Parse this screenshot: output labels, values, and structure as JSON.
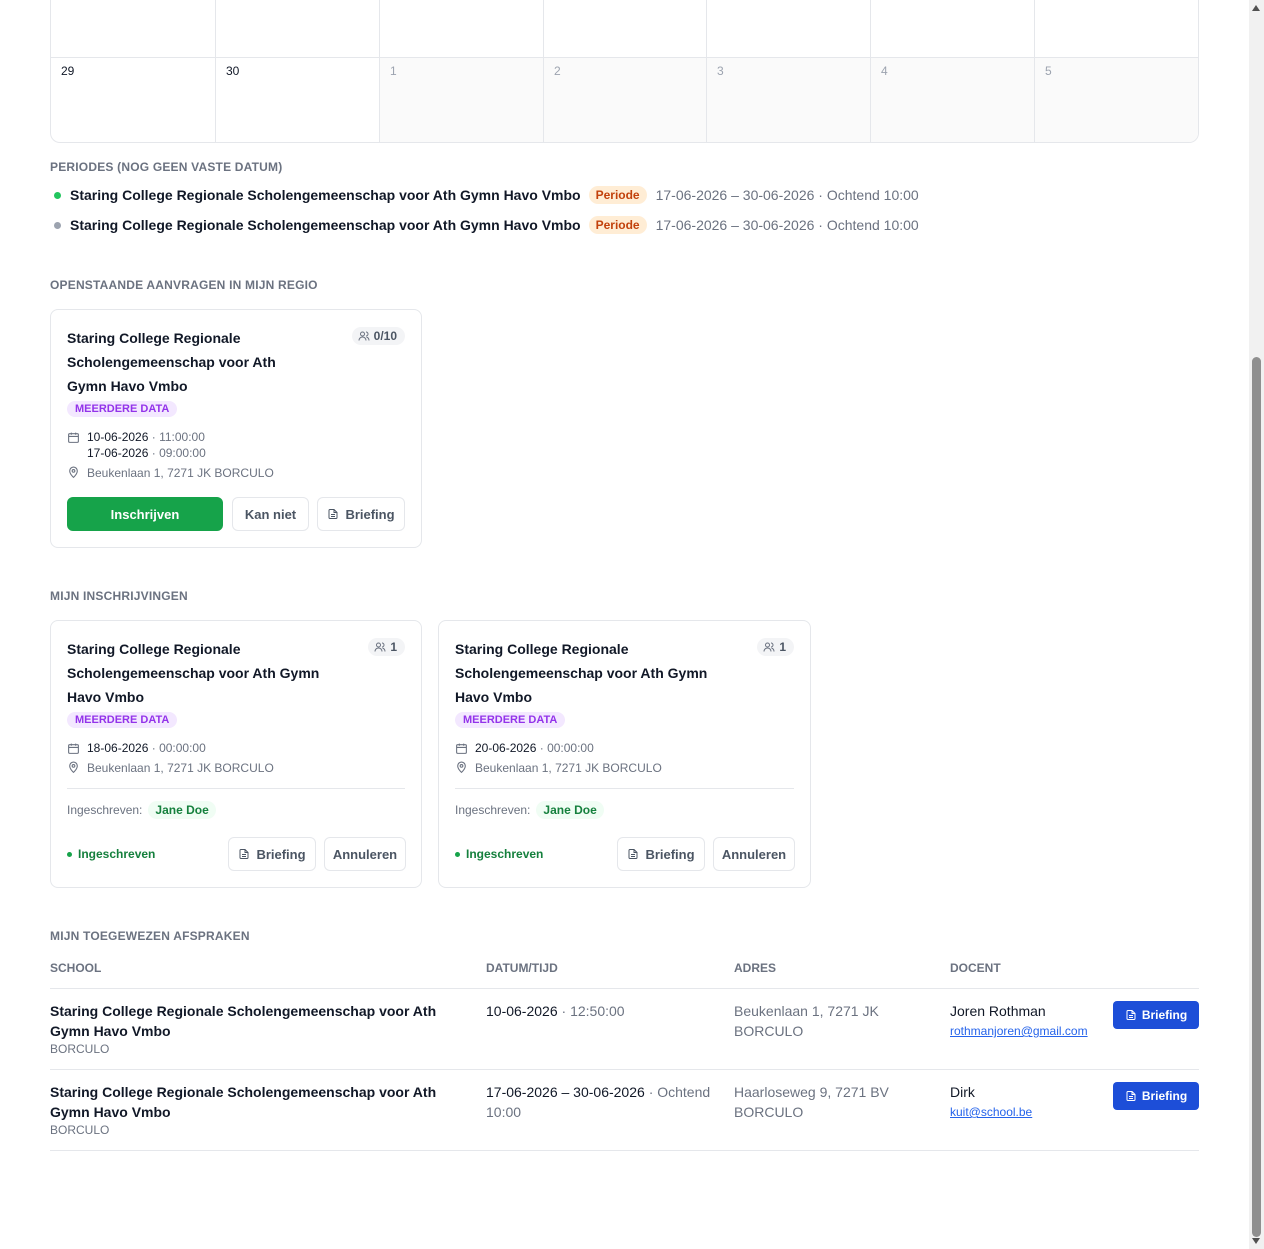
{
  "calendar": {
    "row1": [
      "",
      "",
      "",
      "",
      "",
      "",
      ""
    ],
    "row2": [
      {
        "day": "29",
        "in_month": true
      },
      {
        "day": "30",
        "in_month": true
      },
      {
        "day": "1",
        "in_month": false
      },
      {
        "day": "2",
        "in_month": false
      },
      {
        "day": "3",
        "in_month": false
      },
      {
        "day": "4",
        "in_month": false
      },
      {
        "day": "5",
        "in_month": false
      }
    ]
  },
  "periods": {
    "title": "PERIODES (NOG GEEN VASTE DATUM)",
    "items": [
      {
        "name": "Staring College Regionale Scholengemeenschap voor Ath Gymn Havo Vmbo",
        "badge": "Periode",
        "meta": "17-06-2026 – 30-06-2026 · Ochtend 10:00",
        "dot_color": "#22c55e"
      },
      {
        "name": "Staring College Regionale Scholengemeenschap voor Ath Gymn Havo Vmbo",
        "badge": "Periode",
        "meta": "17-06-2026 – 30-06-2026 · Ochtend 10:00",
        "dot_color": "#9ca3af"
      }
    ]
  },
  "open_requests": {
    "title": "OPENSTAANDE AANVRAGEN IN MIJN REGIO",
    "card": {
      "title": "Staring College Regionale Scholengemeenschap voor Ath Gymn Havo Vmbo",
      "count": "0/10",
      "tag": "MEERDERE DATA",
      "date1": "10-06-2026",
      "time1": "· 11:00:00",
      "date2": "17-06-2026",
      "time2": "· 09:00:00",
      "address": "Beukenlaan 1, 7271 JK BORCULO",
      "btn_signup": "Inschrijven",
      "btn_cant": "Kan niet",
      "btn_briefing": "Briefing"
    }
  },
  "my_registrations": {
    "title": "MIJN INSCHRIJVINGEN",
    "cards": [
      {
        "title": "Staring College Regionale Scholengemeenschap voor Ath Gymn Havo Vmbo",
        "count": "1",
        "tag": "MEERDERE DATA",
        "date": "18-06-2026",
        "time": "· 00:00:00",
        "address": "Beukenlaan 1, 7271 JK BORCULO",
        "registered_label": "Ingeschreven:",
        "registered_name": "Jane Doe",
        "status": "Ingeschreven",
        "btn_briefing": "Briefing",
        "btn_cancel": "Annuleren"
      },
      {
        "title": "Staring College Regionale Scholengemeenschap voor Ath Gymn Havo Vmbo",
        "count": "1",
        "tag": "MEERDERE DATA",
        "date": "20-06-2026",
        "time": "· 00:00:00",
        "address": "Beukenlaan 1, 7271 JK BORCULO",
        "registered_label": "Ingeschreven:",
        "registered_name": "Jane Doe",
        "status": "Ingeschreven",
        "btn_briefing": "Briefing",
        "btn_cancel": "Annuleren"
      }
    ]
  },
  "assigned": {
    "title": "MIJN TOEGEWEZEN AFSPRAKEN",
    "headers": {
      "school": "SCHOOL",
      "datetime": "DATUM/TIJD",
      "address": "ADRES",
      "teacher": "DOCENT"
    },
    "rows": [
      {
        "school": "Staring College Regionale Scholengemeenschap voor Ath Gymn Havo Vmbo",
        "city": "BORCULO",
        "date": "10-06-2026",
        "time": "· 12:50:00",
        "address": "Beukenlaan 1, 7271 JK BORCULO",
        "teacher": "Joren Rothman",
        "email": "rothmanjoren@gmail.com",
        "btn": "Briefing"
      },
      {
        "school": "Staring College Regionale Scholengemeenschap voor Ath Gymn Havo Vmbo",
        "city": "BORCULO",
        "date": "17-06-2026 – 30-06-2026",
        "time": "· Ochtend 10:00",
        "address": "Haarloseweg 9, 7271 BV BORCULO",
        "teacher": "Dirk",
        "email": "kuit@school.be",
        "btn": "Briefing"
      }
    ]
  },
  "icons": {
    "calendar": "calendar-icon",
    "pin": "map-pin-icon",
    "users": "users-icon",
    "doc": "document-icon"
  }
}
